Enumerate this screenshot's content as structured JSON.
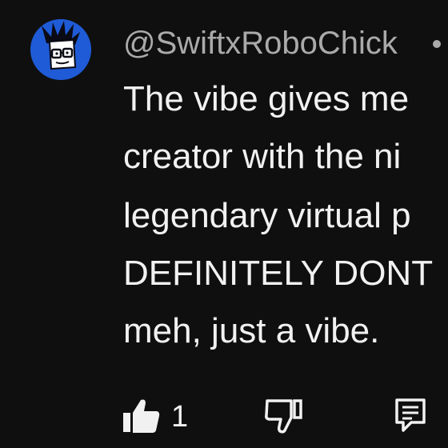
{
  "comment": {
    "username": "@SwiftxRoboChick",
    "lines": [
      "The vibe gives me",
      "creator with the ni",
      "legendary virtual p",
      "DEFINITELY DONT",
      "meh, just a vibe."
    ]
  },
  "actions": {
    "like_count": "1",
    "like_icon": "thumbs-up-icon",
    "dislike_icon": "thumbs-down-icon",
    "reply_icon": "comment-icon"
  },
  "colors": {
    "background": "#0f0f0f",
    "text_primary": "#f1f1f1",
    "text_secondary": "#aaaaaa",
    "avatar_bg": "#1f5bd6"
  }
}
